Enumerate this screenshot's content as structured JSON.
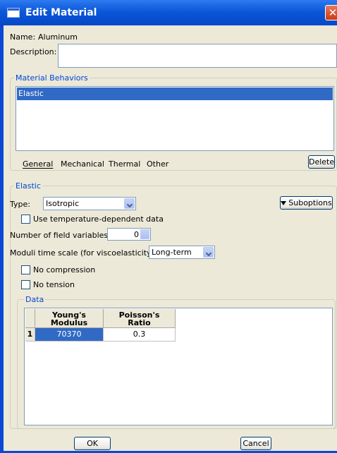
{
  "window": {
    "title": "Edit Material",
    "close_glyph": "✕"
  },
  "name": {
    "label": "Name:",
    "value": "Aluminum"
  },
  "description": {
    "label": "Description:",
    "value": ""
  },
  "behaviors": {
    "group_label": "Material Behaviors",
    "items": [
      "Elastic"
    ],
    "selected": "Elastic",
    "menus": [
      "General",
      "Mechanical",
      "Thermal",
      "Other"
    ],
    "delete_label": "Delete"
  },
  "elastic": {
    "group_label": "Elastic",
    "type_label": "Type:",
    "type_value": "Isotropic",
    "suboptions_label": "Suboptions",
    "temp_dependent_label": "Use temperature-dependent data",
    "temp_dependent_checked": false,
    "field_vars_label": "Number of field variables:",
    "field_vars_value": "0",
    "moduli_label": "Moduli time scale (for viscoelasticity):",
    "moduli_value": "Long-term",
    "no_compression_label": "No compression",
    "no_compression_checked": false,
    "no_tension_label": "No tension",
    "no_tension_checked": false
  },
  "data": {
    "group_label": "Data",
    "columns": [
      {
        "line1": "Young's",
        "line2": "Modulus"
      },
      {
        "line1": "Poisson's",
        "line2": "Ratio"
      }
    ],
    "rows": [
      {
        "index": "1",
        "cells": [
          "70370",
          "0.3"
        ]
      }
    ]
  },
  "footer": {
    "ok_label": "OK",
    "cancel_label": "Cancel"
  },
  "colors": {
    "title_bar": "#0a56d8",
    "accent": "#0046d5",
    "selection": "#316ac5",
    "dialog_bg": "#ece9d8"
  }
}
